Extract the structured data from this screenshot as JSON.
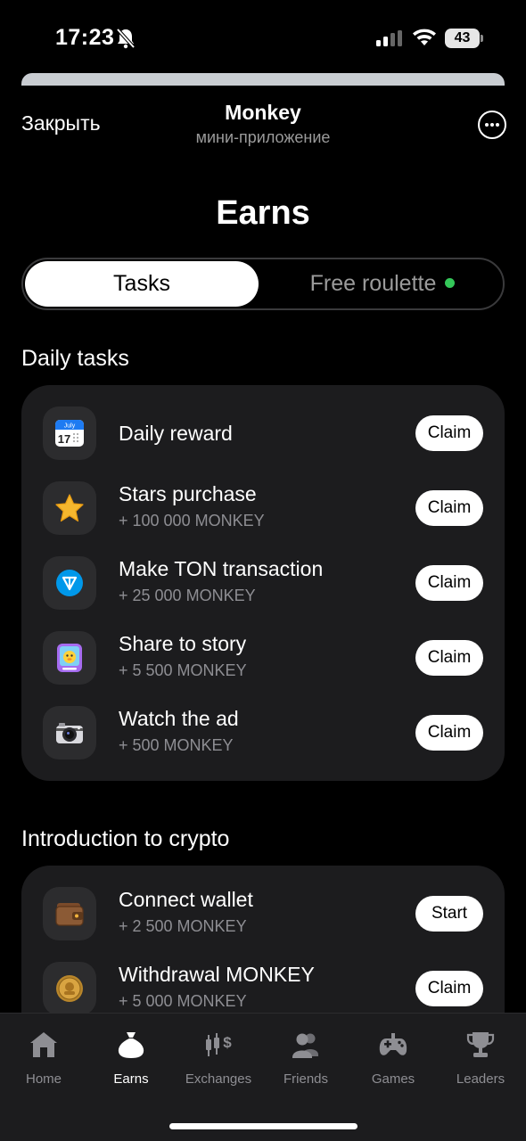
{
  "status_bar": {
    "time": "17:23",
    "battery": "43"
  },
  "header": {
    "close_label": "Закрыть",
    "title": "Monkey",
    "subtitle": "мини-приложение"
  },
  "page_title": "Earns",
  "tabs": [
    {
      "label": "Tasks",
      "active": true
    },
    {
      "label": "Free roulette",
      "indicator_color": "#34c759"
    }
  ],
  "daily_tasks": {
    "title": "Daily tasks",
    "items": [
      {
        "icon": "calendar-icon",
        "title": "Daily reward",
        "reward": "",
        "button": "Claim",
        "icon_text": "July",
        "icon_day": "17"
      },
      {
        "icon": "star-icon",
        "title": "Stars purchase",
        "reward": "+ 100 000 MONKEY",
        "button": "Claim"
      },
      {
        "icon": "ton-icon",
        "title": "Make TON transaction",
        "reward": "+ 25 000 MONKEY",
        "button": "Claim"
      },
      {
        "icon": "story-icon",
        "title": "Share to story",
        "reward": "+ 5 500 MONKEY",
        "button": "Claim"
      },
      {
        "icon": "camera-icon",
        "title": "Watch the ad",
        "reward": "+ 500 MONKEY",
        "button": "Claim"
      }
    ]
  },
  "crypto_tasks": {
    "title": "Introduction to crypto",
    "items": [
      {
        "icon": "wallet-icon",
        "title": "Connect wallet",
        "reward": "+ 2 500 MONKEY",
        "button": "Start"
      },
      {
        "icon": "coin-icon",
        "title": "Withdrawal MONKEY",
        "reward": "+ 5 000 MONKEY",
        "button": "Claim"
      }
    ]
  },
  "bottom_nav": [
    {
      "icon": "home-icon",
      "label": "Home"
    },
    {
      "icon": "moneybag-icon",
      "label": "Earns",
      "active": true
    },
    {
      "icon": "exchange-icon",
      "label": "Exchanges"
    },
    {
      "icon": "friends-icon",
      "label": "Friends"
    },
    {
      "icon": "gamepad-icon",
      "label": "Games"
    },
    {
      "icon": "trophy-icon",
      "label": "Leaders"
    }
  ]
}
